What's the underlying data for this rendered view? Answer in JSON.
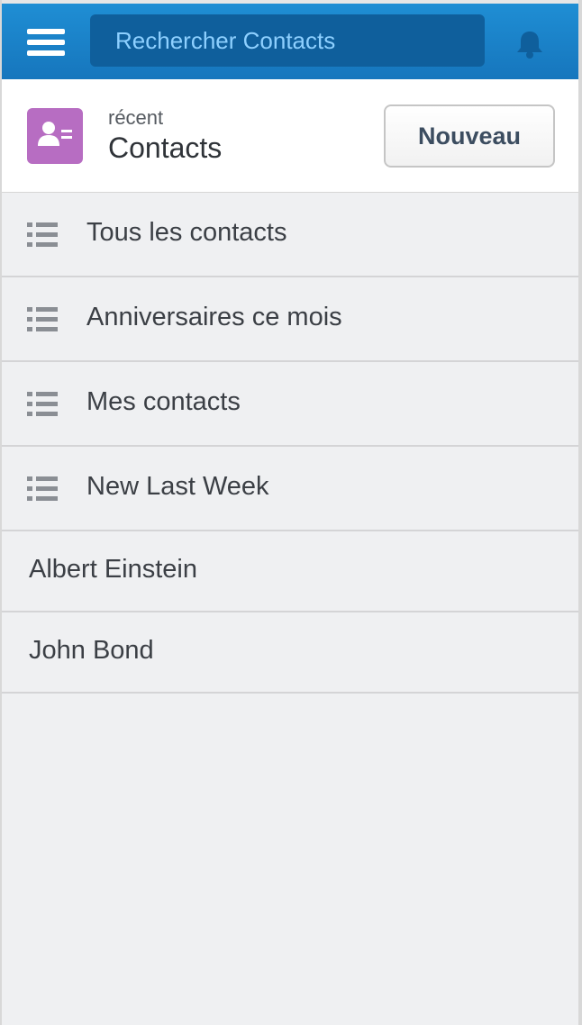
{
  "topbar": {
    "menu_icon": "hamburger-menu-icon",
    "search_placeholder": "Rechercher Contacts",
    "bell_icon": "bell-icon"
  },
  "header": {
    "object_icon": "contact-card-icon",
    "object_icon_color": "#b76dc2",
    "subtitle": "récent",
    "title": "Contacts",
    "new_button_label": "Nouveau"
  },
  "list_views": [
    {
      "label": "Tous les contacts",
      "icon": "list-icon"
    },
    {
      "label": "Anniversaires ce mois",
      "icon": "list-icon"
    },
    {
      "label": "Mes contacts",
      "icon": "list-icon"
    },
    {
      "label": "New Last Week",
      "icon": "list-icon"
    }
  ],
  "recent_records": [
    {
      "label": "Albert Einstein"
    },
    {
      "label": "John Bond"
    }
  ],
  "colors": {
    "topbar": "#1676bd",
    "search_bg": "#0f5f9c",
    "background": "#eff0f2"
  }
}
